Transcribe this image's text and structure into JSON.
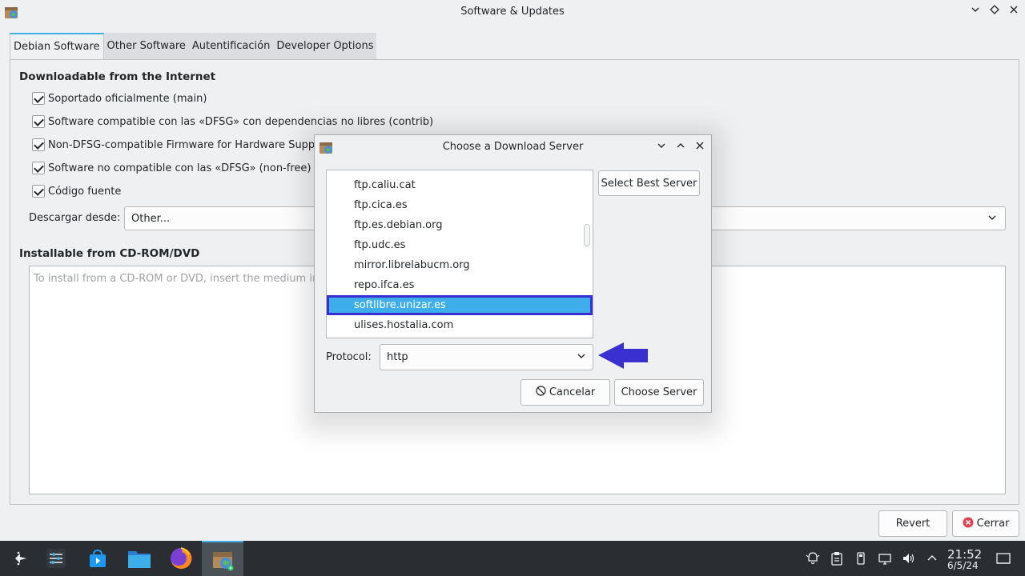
{
  "window": {
    "title": "Software & Updates",
    "buttons": {
      "minimize": "⌄",
      "maximize": "◇",
      "close": "✕"
    }
  },
  "tabs": [
    {
      "label": "Debian Software",
      "active": true
    },
    {
      "label": "Other Software",
      "active": false
    },
    {
      "label": "Autentificación",
      "active": false
    },
    {
      "label": "Developer Options",
      "active": false
    }
  ],
  "internet": {
    "heading": "Downloadable from the Internet",
    "options": [
      {
        "label": "Soportado oficialmente (main)",
        "checked": true
      },
      {
        "label": "Software compatible con las «DFSG» con dependencias no libres (contrib)",
        "checked": true
      },
      {
        "label": "Non-DFSG-compatible Firmware for Hardware Support",
        "checked": true
      },
      {
        "label": "Software no compatible con las «DFSG» (non-free)",
        "checked": true
      },
      {
        "label": "Código fuente",
        "checked": true
      }
    ],
    "download_from_label": "Descargar desde:",
    "download_from_value": "Other..."
  },
  "cdrom": {
    "heading": "Installable from CD-ROM/DVD",
    "hint": "To install from a CD-ROM or DVD, insert the medium into t"
  },
  "footer": {
    "revert": "Revert",
    "close": "Cerrar"
  },
  "dialog": {
    "title": "Choose a Download Server",
    "servers": [
      "ftp.caliu.cat",
      "ftp.cica.es",
      "ftp.es.debian.org",
      "ftp.udc.es",
      "mirror.librelabucm.org",
      "repo.ifca.es",
      "softlibre.unizar.es",
      "ulises.hostalia.com"
    ],
    "selected_server": "softlibre.unizar.es",
    "select_best": "Select Best Server",
    "protocol_label": "Protocol:",
    "protocol_value": "http",
    "cancel": "Cancelar",
    "choose": "Choose Server"
  },
  "taskbar": {
    "time": "21:52",
    "date": "6/5/24"
  },
  "colors": {
    "accent": "#3daee9",
    "annotation_arrow": "#3a2fd1",
    "taskbar_bg": "#2a2e32"
  }
}
